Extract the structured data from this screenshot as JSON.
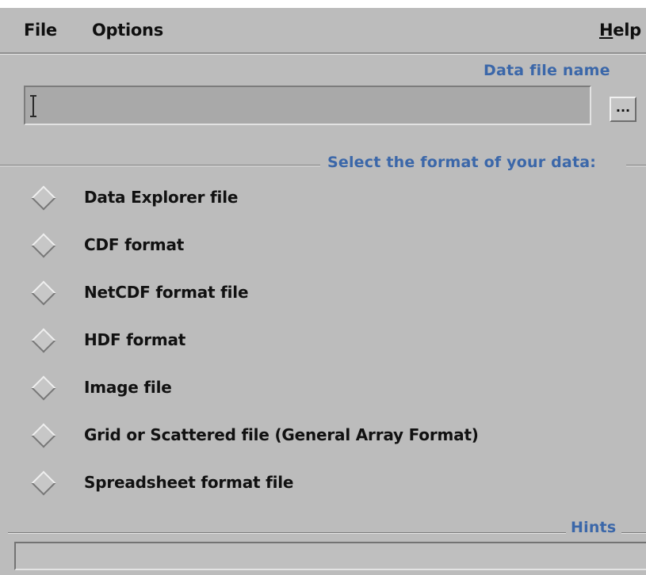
{
  "menubar": {
    "file": "File",
    "options": "Options",
    "help": "Help"
  },
  "data_file": {
    "label": "Data file name",
    "value": "",
    "browse_label": "..."
  },
  "format_section": {
    "label": "Select the format of your data:",
    "options": [
      "Data Explorer file",
      "CDF format",
      "NetCDF format file",
      "HDF format",
      "Image file",
      "Grid or Scattered file (General Array Format)",
      "Spreadsheet format file"
    ]
  },
  "hints": {
    "label": "Hints",
    "text": ""
  },
  "colors": {
    "background": "#bcbcbc",
    "label_blue": "#3b67a9",
    "input_bg": "#a9a9a9"
  }
}
